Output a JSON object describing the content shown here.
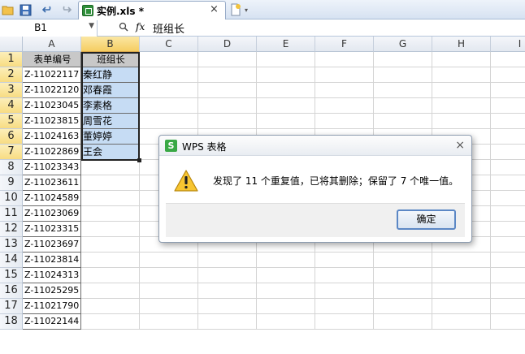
{
  "tab": {
    "title": "实例.xls *",
    "close_glyph": "×"
  },
  "formula_bar": {
    "name_box": "B1",
    "fx_label": "fx",
    "value": "班组长"
  },
  "grid": {
    "columns": [
      "A",
      "B",
      "C",
      "D",
      "E",
      "F",
      "G",
      "H",
      "I"
    ],
    "rows": [
      "1",
      "2",
      "3",
      "4",
      "5",
      "6",
      "7",
      "8",
      "9",
      "10",
      "11",
      "12",
      "13",
      "14",
      "15",
      "16",
      "17",
      "18"
    ],
    "col_a": [
      "表单编号",
      "Z-11022117",
      "Z-11022120",
      "Z-11023045",
      "Z-11023815",
      "Z-11024163",
      "Z-11022869",
      "Z-11023343",
      "Z-11023611",
      "Z-11024589",
      "Z-11023069",
      "Z-11023315",
      "Z-11023697",
      "Z-11023814",
      "Z-11024313",
      "Z-11025295",
      "Z-11021790",
      "Z-11022144"
    ],
    "col_b": [
      "班组长",
      "秦红静",
      "邓春霞",
      "李素格",
      "周雪花",
      "董婷婷",
      "王会"
    ]
  },
  "dialog": {
    "title": "WPS 表格",
    "logo_letter": "S",
    "message": "发现了 11 个重复值，已将其删除；保留了 7 个唯一值。",
    "ok_label": "确定",
    "close_glyph": "×"
  },
  "colors": {
    "selection_fill": "#c6dcf4",
    "header_fill": "#c8c8c8",
    "dialog_button_border": "#5b87c5"
  }
}
